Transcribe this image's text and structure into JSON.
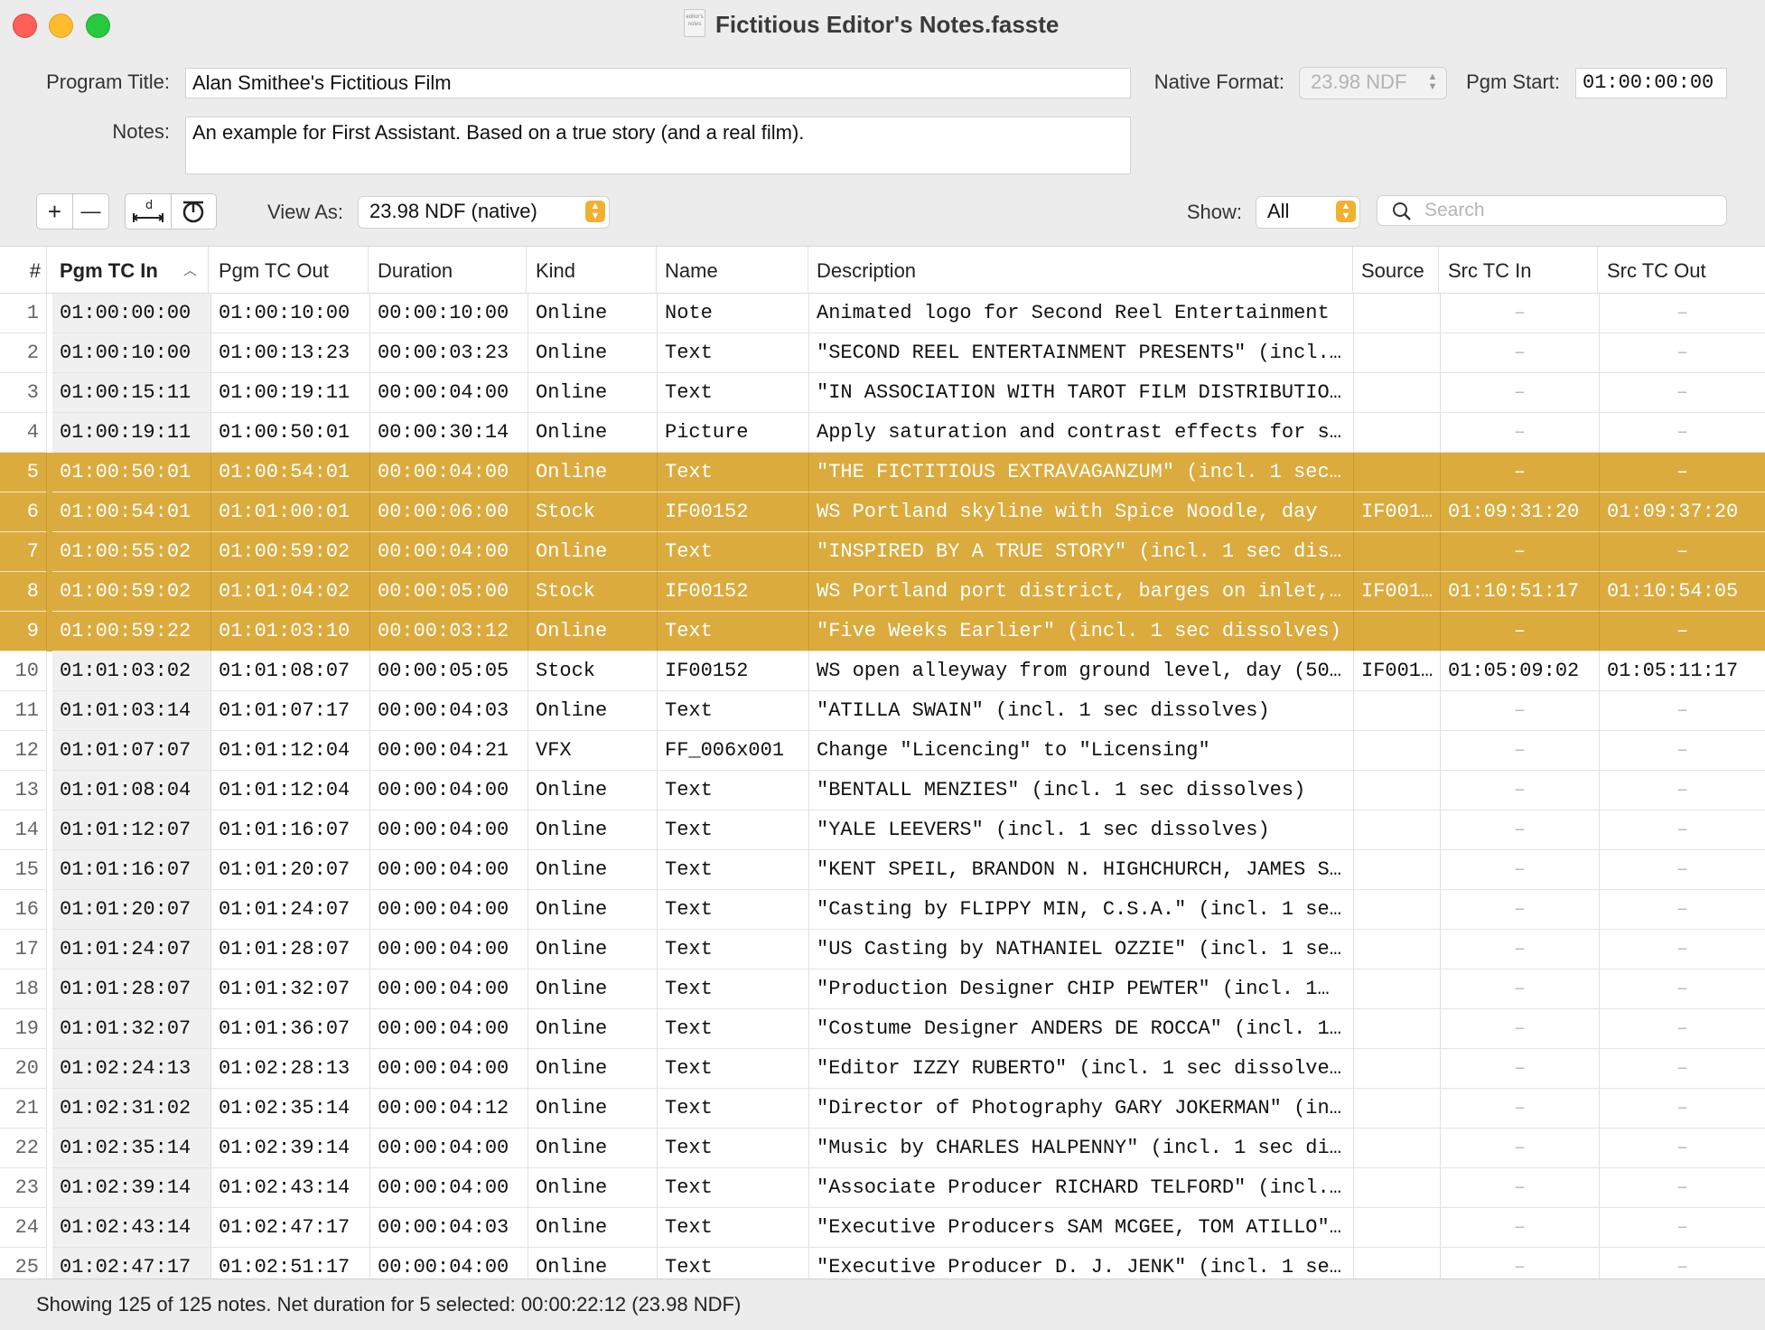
{
  "window": {
    "title": "Fictitious Editor's Notes.fasste",
    "doc_icon_label": "editor's notes"
  },
  "form": {
    "program_title_label": "Program Title:",
    "program_title_value": "Alan Smithee's Fictitious Film",
    "notes_label": "Notes:",
    "notes_value": "An example for First Assistant.  Based on a true story (and a real film).",
    "native_format_label": "Native Format:",
    "native_format_value": "23.98 NDF",
    "pgm_start_label": "Pgm Start:",
    "pgm_start_value": "01:00:00:00"
  },
  "toolbar": {
    "add_label": "+",
    "remove_label": "—",
    "view_as_label": "View As:",
    "view_as_value": "23.98 NDF (native)",
    "show_label": "Show:",
    "show_value": "All",
    "search_placeholder": "Search"
  },
  "table": {
    "columns": [
      "#",
      "Pgm TC In",
      "Pgm TC Out",
      "Duration",
      "Kind",
      "Name",
      "Description",
      "Source",
      "Src TC In",
      "Src TC Out"
    ],
    "sorted_column": "Pgm TC In",
    "selected_color": "#dbab3e",
    "rows": [
      {
        "num": "1",
        "tcin": "01:00:00:00",
        "tcout": "01:00:10:00",
        "dur": "00:00:10:00",
        "kind": "Online",
        "name": "Note",
        "desc": "Animated logo for Second Reel Entertainment",
        "source": "",
        "srcin": "–",
        "srcout": "–",
        "selected": false
      },
      {
        "num": "2",
        "tcin": "01:00:10:00",
        "tcout": "01:00:13:23",
        "dur": "00:00:03:23",
        "kind": "Online",
        "name": "Text",
        "desc": "\"SECOND REEL ENTERTAINMENT PRESENTS\" (incl.…",
        "source": "",
        "srcin": "–",
        "srcout": "–",
        "selected": false
      },
      {
        "num": "3",
        "tcin": "01:00:15:11",
        "tcout": "01:00:19:11",
        "dur": "00:00:04:00",
        "kind": "Online",
        "name": "Text",
        "desc": "\"IN ASSOCIATION WITH TAROT FILM DISTRIBUTIO…",
        "source": "",
        "srcin": "–",
        "srcout": "–",
        "selected": false
      },
      {
        "num": "4",
        "tcin": "01:00:19:11",
        "tcout": "01:00:50:01",
        "dur": "00:00:30:14",
        "kind": "Online",
        "name": "Picture",
        "desc": "Apply saturation and contrast effects for s…",
        "source": "",
        "srcin": "–",
        "srcout": "–",
        "selected": false
      },
      {
        "num": "5",
        "tcin": "01:00:50:01",
        "tcout": "01:00:54:01",
        "dur": "00:00:04:00",
        "kind": "Online",
        "name": "Text",
        "desc": "\"THE FICTITIOUS EXTRAVAGANZUM\" (incl. 1 sec…",
        "source": "",
        "srcin": "–",
        "srcout": "–",
        "selected": true
      },
      {
        "num": "6",
        "tcin": "01:00:54:01",
        "tcout": "01:01:00:01",
        "dur": "00:00:06:00",
        "kind": "Stock",
        "name": "IF00152",
        "desc": "WS Portland skyline with Spice Noodle, day",
        "source": "IF001…",
        "srcin": "01:09:31:20",
        "srcout": "01:09:37:20",
        "selected": true
      },
      {
        "num": "7",
        "tcin": "01:00:55:02",
        "tcout": "01:00:59:02",
        "dur": "00:00:04:00",
        "kind": "Online",
        "name": "Text",
        "desc": "\"INSPIRED BY A TRUE STORY\" (incl. 1 sec dis…",
        "source": "",
        "srcin": "–",
        "srcout": "–",
        "selected": true
      },
      {
        "num": "8",
        "tcin": "01:00:59:02",
        "tcout": "01:01:04:02",
        "dur": "00:00:05:00",
        "kind": "Stock",
        "name": "IF00152",
        "desc": "WS Portland port district, barges on inlet,…",
        "source": "IF001…",
        "srcin": "01:10:51:17",
        "srcout": "01:10:54:05",
        "selected": true
      },
      {
        "num": "9",
        "tcin": "01:00:59:22",
        "tcout": "01:01:03:10",
        "dur": "00:00:03:12",
        "kind": "Online",
        "name": "Text",
        "desc": "\"Five Weeks Earlier\" (incl. 1 sec dissolves)",
        "source": "",
        "srcin": "–",
        "srcout": "–",
        "selected": true
      },
      {
        "num": "10",
        "tcin": "01:01:03:02",
        "tcout": "01:01:08:07",
        "dur": "00:00:05:05",
        "kind": "Stock",
        "name": "IF00152",
        "desc": "WS open alleyway from ground level, day (50…",
        "source": "IF001…",
        "srcin": "01:05:09:02",
        "srcout": "01:05:11:17",
        "selected": false
      },
      {
        "num": "11",
        "tcin": "01:01:03:14",
        "tcout": "01:01:07:17",
        "dur": "00:00:04:03",
        "kind": "Online",
        "name": "Text",
        "desc": "\"ATILLA SWAIN\" (incl. 1 sec dissolves)",
        "source": "",
        "srcin": "–",
        "srcout": "–",
        "selected": false
      },
      {
        "num": "12",
        "tcin": "01:01:07:07",
        "tcout": "01:01:12:04",
        "dur": "00:00:04:21",
        "kind": "VFX",
        "name": "FF_006x001",
        "desc": "Change \"Licencing\" to \"Licensing\"",
        "source": "",
        "srcin": "–",
        "srcout": "–",
        "selected": false
      },
      {
        "num": "13",
        "tcin": "01:01:08:04",
        "tcout": "01:01:12:04",
        "dur": "00:00:04:00",
        "kind": "Online",
        "name": "Text",
        "desc": "\"BENTALL MENZIES\" (incl. 1 sec dissolves)",
        "source": "",
        "srcin": "–",
        "srcout": "–",
        "selected": false
      },
      {
        "num": "14",
        "tcin": "01:01:12:07",
        "tcout": "01:01:16:07",
        "dur": "00:00:04:00",
        "kind": "Online",
        "name": "Text",
        "desc": "\"YALE LEEVERS\" (incl. 1 sec dissolves)",
        "source": "",
        "srcin": "–",
        "srcout": "–",
        "selected": false
      },
      {
        "num": "15",
        "tcin": "01:01:16:07",
        "tcout": "01:01:20:07",
        "dur": "00:00:04:00",
        "kind": "Online",
        "name": "Text",
        "desc": "\"KENT SPEIL, BRANDON N. HIGHCHURCH, JAMES S…",
        "source": "",
        "srcin": "–",
        "srcout": "–",
        "selected": false
      },
      {
        "num": "16",
        "tcin": "01:01:20:07",
        "tcout": "01:01:24:07",
        "dur": "00:00:04:00",
        "kind": "Online",
        "name": "Text",
        "desc": "\"Casting by FLIPPY MIN, C.S.A.\" (incl. 1 se…",
        "source": "",
        "srcin": "–",
        "srcout": "–",
        "selected": false
      },
      {
        "num": "17",
        "tcin": "01:01:24:07",
        "tcout": "01:01:28:07",
        "dur": "00:00:04:00",
        "kind": "Online",
        "name": "Text",
        "desc": "\"US Casting by NATHANIEL OZZIE\" (incl. 1 se…",
        "source": "",
        "srcin": "–",
        "srcout": "–",
        "selected": false
      },
      {
        "num": "18",
        "tcin": "01:01:28:07",
        "tcout": "01:01:32:07",
        "dur": "00:00:04:00",
        "kind": "Online",
        "name": "Text",
        "desc": "\"Production Designer CHIP PEWTER\" (incl. 1…",
        "source": "",
        "srcin": "–",
        "srcout": "–",
        "selected": false
      },
      {
        "num": "19",
        "tcin": "01:01:32:07",
        "tcout": "01:01:36:07",
        "dur": "00:00:04:00",
        "kind": "Online",
        "name": "Text",
        "desc": "\"Costume Designer ANDERS DE ROCCA\" (incl. 1…",
        "source": "",
        "srcin": "–",
        "srcout": "–",
        "selected": false
      },
      {
        "num": "20",
        "tcin": "01:02:24:13",
        "tcout": "01:02:28:13",
        "dur": "00:00:04:00",
        "kind": "Online",
        "name": "Text",
        "desc": "\"Editor IZZY RUBERTO\" (incl. 1 sec dissolve…",
        "source": "",
        "srcin": "–",
        "srcout": "–",
        "selected": false
      },
      {
        "num": "21",
        "tcin": "01:02:31:02",
        "tcout": "01:02:35:14",
        "dur": "00:00:04:12",
        "kind": "Online",
        "name": "Text",
        "desc": "\"Director of Photography GARY JOKERMAN\" (in…",
        "source": "",
        "srcin": "–",
        "srcout": "–",
        "selected": false
      },
      {
        "num": "22",
        "tcin": "01:02:35:14",
        "tcout": "01:02:39:14",
        "dur": "00:00:04:00",
        "kind": "Online",
        "name": "Text",
        "desc": "\"Music by CHARLES HALPENNY\" (incl. 1 sec di…",
        "source": "",
        "srcin": "–",
        "srcout": "–",
        "selected": false
      },
      {
        "num": "23",
        "tcin": "01:02:39:14",
        "tcout": "01:02:43:14",
        "dur": "00:00:04:00",
        "kind": "Online",
        "name": "Text",
        "desc": "\"Associate Producer RICHARD TELFORD\" (incl.…",
        "source": "",
        "srcin": "–",
        "srcout": "–",
        "selected": false
      },
      {
        "num": "24",
        "tcin": "01:02:43:14",
        "tcout": "01:02:47:17",
        "dur": "00:00:04:03",
        "kind": "Online",
        "name": "Text",
        "desc": "\"Executive Producers SAM MCGEE, TOM ATILLO\"…",
        "source": "",
        "srcin": "–",
        "srcout": "–",
        "selected": false
      },
      {
        "num": "25",
        "tcin": "01:02:47:17",
        "tcout": "01:02:51:17",
        "dur": "00:00:04:00",
        "kind": "Online",
        "name": "Text",
        "desc": "\"Executive Producer D. J. JENK\" (incl. 1 se…",
        "source": "",
        "srcin": "–",
        "srcout": "–",
        "selected": false
      }
    ]
  },
  "status": {
    "text": "Showing 125 of 125 notes. Net duration for 5 selected:  00:00:22:12 (23.98 NDF)"
  }
}
